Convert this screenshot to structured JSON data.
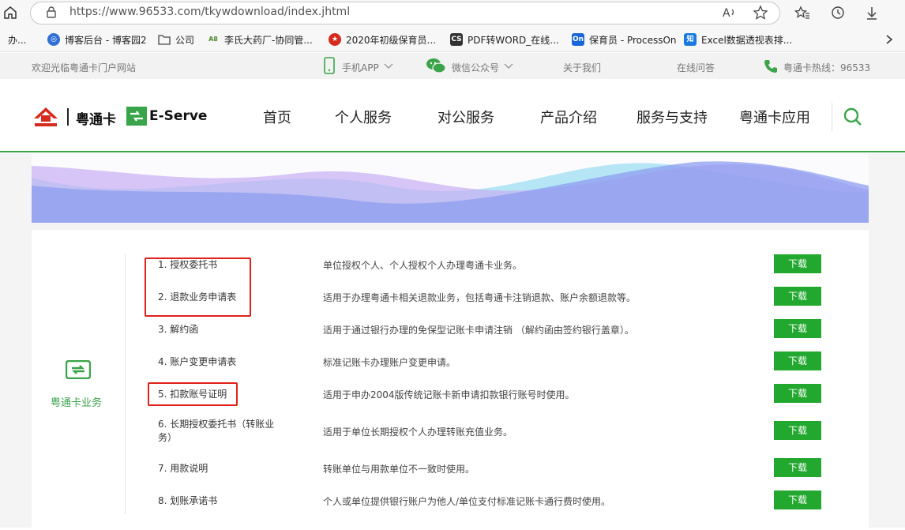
{
  "browser": {
    "url": "https://www.96533.com/tkywdownload/index.jhtml"
  },
  "bookmarks": [
    {
      "label": "办..."
    },
    {
      "label": "博客后台 - 博客园2"
    },
    {
      "label": "公司"
    },
    {
      "label": "李氏大药厂-协同管..."
    },
    {
      "label": "2020年初级保育员..."
    },
    {
      "label": "PDF转WORD_在线..."
    },
    {
      "label": "保育员 - ProcessOn"
    },
    {
      "label": "Excel数据透视表排..."
    }
  ],
  "topbar": {
    "welcome": "欢迎光临粤通卡门户网站",
    "app": "手机APP",
    "wechat": "微信公众号",
    "about": "关于我们",
    "qa": "在线问答",
    "hotline": "粤通卡热线：96533"
  },
  "header": {
    "brand": "粤通卡",
    "eserve": "E-Serve",
    "nav": [
      "首页",
      "个人服务",
      "对公服务",
      "产品介绍",
      "服务与支持",
      "粤通卡应用"
    ]
  },
  "section": {
    "title": "粤通卡业务"
  },
  "download_label": "下载",
  "rows": [
    {
      "name": "1. 授权委托书",
      "desc": "单位授权个人、个人授权个人办理粤通卡业务。"
    },
    {
      "name": "2. 退款业务申请表",
      "desc": "适用于办理粤通卡相关退款业务，包括粤通卡注销退款、账户余额退款等。"
    },
    {
      "name": "3. 解约函",
      "desc": "适用于通过银行办理的免保型记账卡申请注销 （解约函由签约银行盖章）。"
    },
    {
      "name": "4. 账户变更申请表",
      "desc": "标准记账卡办理账户变更申请。"
    },
    {
      "name": "5. 扣款账号证明",
      "desc": "适用于申办2004版传统记账卡新申请扣款银行账号时使用。"
    },
    {
      "name": "6. 长期授权委托书（转账业务）",
      "desc": "适用于单位长期授权个人办理转账充值业务。"
    },
    {
      "name": "7. 用款说明",
      "desc": "转账单位与用款单位不一致时使用。"
    },
    {
      "name": "8. 划账承诺书",
      "desc": "个人或单位提供银行账户为他人/单位支付标准记账卡通行费时使用。"
    }
  ]
}
